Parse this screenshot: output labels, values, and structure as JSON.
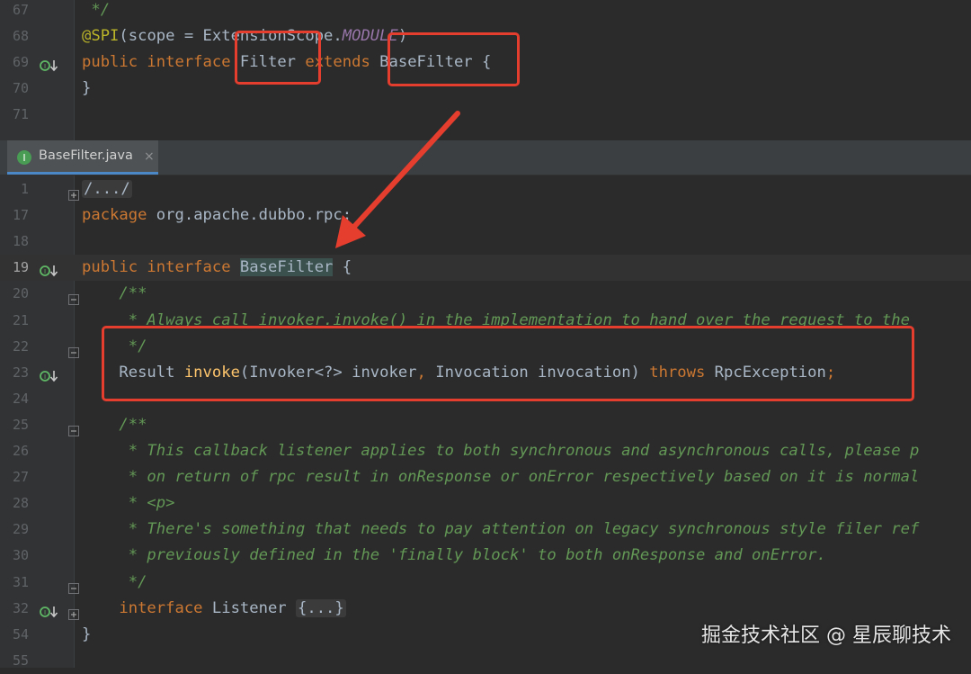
{
  "top_pane": {
    "lines": [
      {
        "n": "67",
        "c": [
          {
            "t": " */",
            "k": "cmt"
          }
        ]
      },
      {
        "n": "68",
        "c": [
          {
            "t": "@SPI",
            "k": "ann"
          },
          {
            "t": "(scope = ExtensionScope.",
            "k": "p"
          },
          {
            "t": "MODULE",
            "k": "const"
          },
          {
            "t": ")",
            "k": "p"
          }
        ]
      },
      {
        "n": "69",
        "mark": "implementation-marker",
        "c": [
          {
            "t": "public interface ",
            "k": "kw"
          },
          {
            "t": "Filter ",
            "k": "p"
          },
          {
            "t": "extends ",
            "k": "kw"
          },
          {
            "t": "BaseFilter {",
            "k": "p"
          }
        ]
      },
      {
        "n": "70",
        "c": [
          {
            "t": "}",
            "k": "p"
          }
        ]
      },
      {
        "n": "71",
        "c": []
      }
    ]
  },
  "tab": {
    "label": "BaseFilter.java",
    "icon": "interface-icon",
    "close": "×"
  },
  "bottom_pane": {
    "lines": [
      {
        "n": "1",
        "fold": "plus",
        "c": [
          {
            "t": "/.../",
            "k": "fold"
          }
        ]
      },
      {
        "n": "17",
        "c": [
          {
            "t": "package ",
            "k": "kw"
          },
          {
            "t": "org.apache.dubbo.rpc;",
            "k": "p"
          }
        ]
      },
      {
        "n": "18",
        "c": []
      },
      {
        "n": "19",
        "cur": true,
        "mark": "implemented-marker",
        "c": [
          {
            "t": "public interface ",
            "k": "kw"
          },
          {
            "t": "BaseFilter",
            "k": "ident"
          },
          {
            "t": " {",
            "k": "p"
          }
        ]
      },
      {
        "n": "20",
        "fold": "minus",
        "c": [
          {
            "t": "    /**",
            "k": "cmt"
          }
        ]
      },
      {
        "n": "21",
        "c": [
          {
            "t": "     * Always call invoker.invoke() in the implementation to hand over the request to the",
            "k": "cmt"
          }
        ]
      },
      {
        "n": "22",
        "fold": "minus",
        "c": [
          {
            "t": "     */",
            "k": "cmt"
          }
        ]
      },
      {
        "n": "23",
        "mark": "implemented-marker",
        "c": [
          {
            "t": "    Result ",
            "k": "p"
          },
          {
            "t": "invoke",
            "k": "mth"
          },
          {
            "t": "(Invoker<?> invoker",
            "k": "p"
          },
          {
            "t": ", ",
            "k": "kw"
          },
          {
            "t": "Invocation invocation) ",
            "k": "p"
          },
          {
            "t": "throws ",
            "k": "kw"
          },
          {
            "t": "RpcException",
            "k": "p"
          },
          {
            "t": ";",
            "k": "kw"
          }
        ]
      },
      {
        "n": "24",
        "c": []
      },
      {
        "n": "25",
        "fold": "minus",
        "c": [
          {
            "t": "    /**",
            "k": "cmt"
          }
        ]
      },
      {
        "n": "26",
        "c": [
          {
            "t": "     * This callback listener applies to both synchronous and asynchronous calls, please p",
            "k": "cmt"
          }
        ]
      },
      {
        "n": "27",
        "c": [
          {
            "t": "     * on return of rpc result in onResponse or onError respectively based on it is normal",
            "k": "cmt"
          }
        ]
      },
      {
        "n": "28",
        "c": [
          {
            "t": "     * <p>",
            "k": "cmt"
          }
        ]
      },
      {
        "n": "29",
        "c": [
          {
            "t": "     * There's something that needs to pay attention on legacy synchronous style filer ref",
            "k": "cmt"
          }
        ]
      },
      {
        "n": "30",
        "c": [
          {
            "t": "     * previously defined in the 'finally block' to both onResponse and onError.",
            "k": "cmt"
          }
        ]
      },
      {
        "n": "31",
        "fold": "minus",
        "c": [
          {
            "t": "     */",
            "k": "cmt"
          }
        ]
      },
      {
        "n": "32",
        "mark": "implemented-marker",
        "fold": "plus",
        "c": [
          {
            "t": "    interface ",
            "k": "kw"
          },
          {
            "t": "Listener ",
            "k": "p"
          },
          {
            "t": "{...}",
            "k": "fold"
          }
        ]
      },
      {
        "n": "54",
        "c": [
          {
            "t": "}",
            "k": "p"
          }
        ]
      },
      {
        "n": "55",
        "c": []
      }
    ]
  },
  "watermark": "掘金技术社区 @ 星辰聊技术",
  "colors": {
    "background": "#2b2b2b",
    "keyword": "#cc7832",
    "annotation": "#bbb529",
    "comment": "#629755",
    "method": "#ffc66d",
    "highlight_box": "#e53d2e"
  }
}
